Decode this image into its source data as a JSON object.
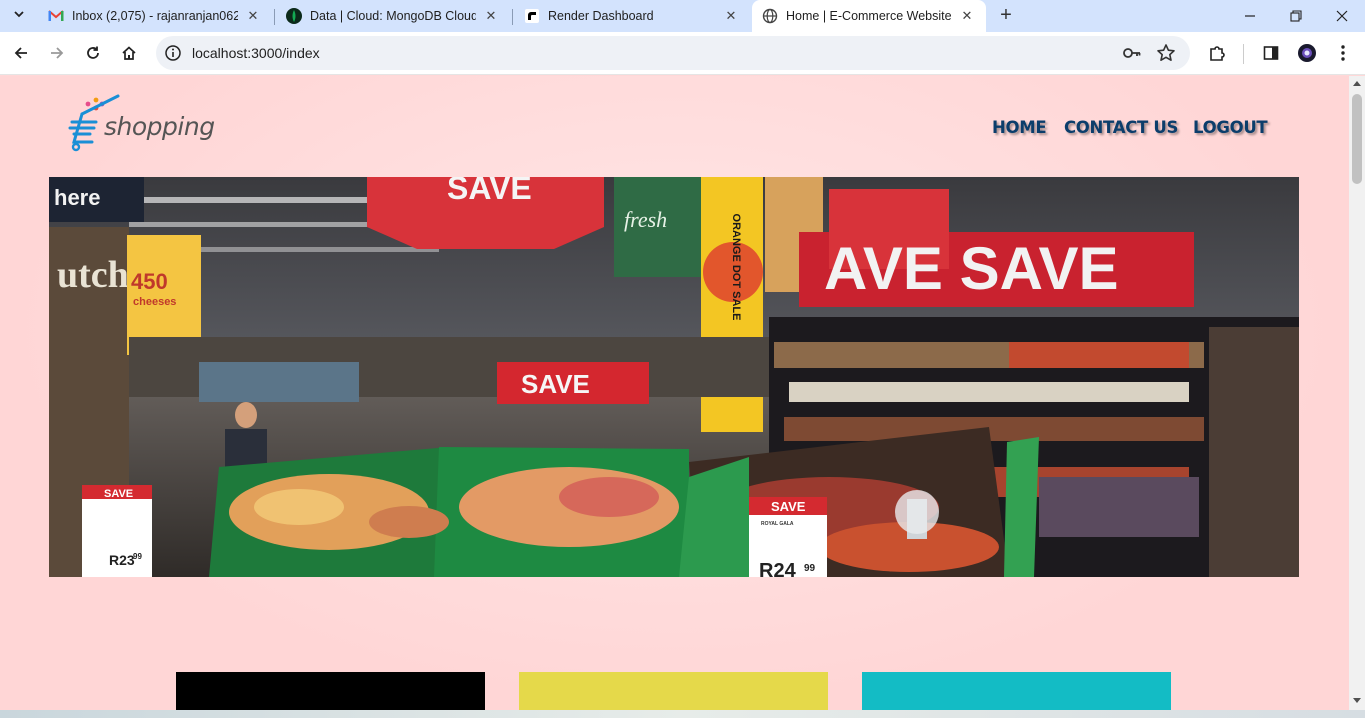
{
  "browser": {
    "tabs": [
      {
        "title": "Inbox (2,075) - rajanranjan0625",
        "icon": "gmail-icon"
      },
      {
        "title": "Data | Cloud: MongoDB Cloud",
        "icon": "mongodb-icon"
      },
      {
        "title": "Render Dashboard",
        "icon": "render-icon"
      },
      {
        "title": "Home | E-Commerce Website.",
        "icon": "globe-icon",
        "active": true
      }
    ],
    "url": "localhost:3000/index"
  },
  "site": {
    "logo_text": "shopping",
    "nav": {
      "home": "HOME",
      "contact": "CONTACT US",
      "logout": "LOGOUT"
    },
    "hero": {
      "signs": {
        "save_top": "SAVE",
        "here": "here",
        "butch": "utch",
        "promo_price": "450",
        "promo_text": "cheeses",
        "fresh": "fresh",
        "orange_dot": "ORANGE DOT SALE",
        "save_right": "AVE  SAVE",
        "save_center": "SAVE",
        "save_left_card": "SAVE",
        "price_left": "R23",
        "price_left_cents": "99",
        "save_right_card": "SAVE",
        "product_right": "ROYAL GALA",
        "price_right": "R24",
        "price_right_cents": "99"
      }
    },
    "cards": [
      {
        "color": "#000000"
      },
      {
        "color": "#e5d94a"
      },
      {
        "color": "#13bcc5"
      }
    ]
  }
}
